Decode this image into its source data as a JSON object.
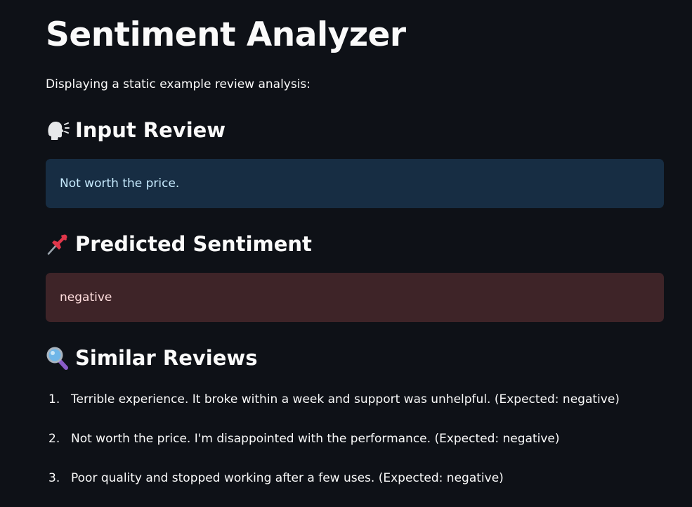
{
  "page": {
    "title": "Sentiment Analyzer",
    "intro": "Displaying a static example review analysis:"
  },
  "input_section": {
    "icon": "speaking-head-icon",
    "heading": "Input Review",
    "review_text": "Not worth the price.",
    "box_color": "#172d43"
  },
  "predicted_section": {
    "icon": "pushpin-icon",
    "heading": "Predicted Sentiment",
    "sentiment": "negative",
    "box_color": "#3e2428"
  },
  "similar_section": {
    "icon": "magnifying-glass-icon",
    "heading": "Similar Reviews",
    "items": [
      {
        "number": "1.",
        "text": "Terrible experience. It broke within a week and support was unhelpful. (Expected: negative)"
      },
      {
        "number": "2.",
        "text": "Not worth the price. I'm disappointed with the performance. (Expected: negative)"
      },
      {
        "number": "3.",
        "text": "Poor quality and stopped working after a few uses. (Expected: negative)"
      }
    ]
  }
}
